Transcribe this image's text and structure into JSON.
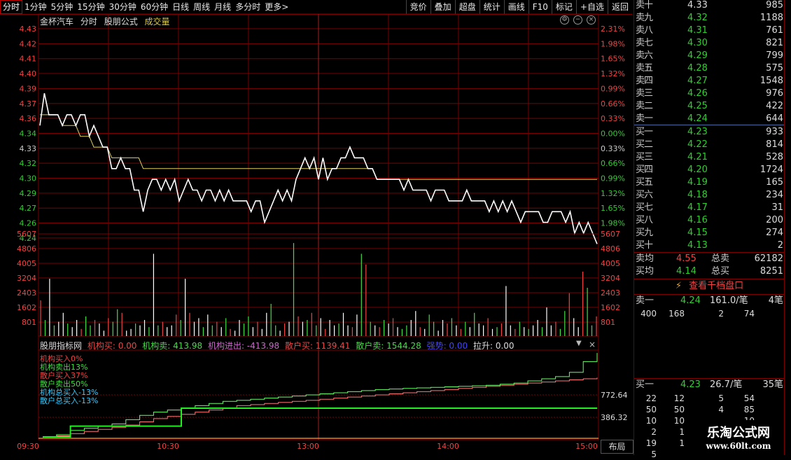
{
  "topbar": {
    "tabs": [
      "分时",
      "1分钟",
      "5分钟",
      "15分钟",
      "30分钟",
      "60分钟",
      "日线",
      "周线",
      "月线",
      "多分时",
      "更多>"
    ],
    "active_tab": "分时",
    "right_buttons": [
      "竞价",
      "叠加",
      "超盘",
      "统计",
      "画线",
      "F10",
      "标记",
      "+自选",
      "返回"
    ]
  },
  "chart_header": {
    "stock_name": "金杯汽车",
    "mode": "分时",
    "formula": "股朋公式",
    "volume_label": "成交量"
  },
  "chart_data": [
    {
      "type": "line",
      "name": "intraday-price",
      "y_ticks_left": [
        "4.43",
        "4.42",
        "4.41",
        "4.40",
        "4.39",
        "4.37",
        "4.36",
        "4.34",
        "4.33",
        "4.32",
        "4.30",
        "4.29",
        "4.27",
        "4.26",
        "4.24"
      ],
      "y_ticks_right": [
        "2.31%",
        "1.98%",
        "1.65%",
        "1.32%",
        "0.99%",
        "0.66%",
        "0.33%",
        "0.00%",
        "0.33%",
        "0.66%",
        "0.99%",
        "1.32%",
        "1.65%",
        "1.98%"
      ],
      "ylim": [
        4.23,
        4.43
      ],
      "prev_close": 4.33,
      "x_ticks": [
        "09:30",
        "10:30",
        "13:00",
        "14:00",
        "15:00"
      ],
      "price": [
        4.34,
        4.37,
        4.35,
        4.35,
        4.35,
        4.34,
        4.35,
        4.35,
        4.34,
        4.35,
        4.35,
        4.33,
        4.34,
        4.33,
        4.32,
        4.32,
        4.3,
        4.3,
        4.31,
        4.3,
        4.3,
        4.28,
        4.28,
        4.26,
        4.28,
        4.29,
        4.29,
        4.28,
        4.29,
        4.28,
        4.29,
        4.27,
        4.28,
        4.29,
        4.28,
        4.28,
        4.27,
        4.28,
        4.28,
        4.27,
        4.28,
        4.27,
        4.28,
        4.27,
        4.27,
        4.27,
        4.27,
        4.26,
        4.27,
        4.27,
        4.25,
        4.26,
        4.27,
        4.28,
        4.27,
        4.28,
        4.27,
        4.29,
        4.3,
        4.31,
        4.3,
        4.31,
        4.29,
        4.31,
        4.29,
        4.3,
        4.3,
        4.31,
        4.31,
        4.32,
        4.31,
        4.31,
        4.31,
        4.3,
        4.3,
        4.29,
        4.29,
        4.29,
        4.29,
        4.29,
        4.29,
        4.28,
        4.29,
        4.28,
        4.28,
        4.28,
        4.28,
        4.27,
        4.28,
        4.28,
        4.28,
        4.27,
        4.27,
        4.27,
        4.27,
        4.28,
        4.27,
        4.27,
        4.27,
        4.27,
        4.26,
        4.27,
        4.26,
        4.27,
        4.26,
        4.27,
        4.26,
        4.25,
        4.26,
        4.26,
        4.26,
        4.26,
        4.25,
        4.25,
        4.26,
        4.26,
        4.26,
        4.25,
        4.26,
        4.24,
        4.25,
        4.24,
        4.25,
        4.24,
        4.23
      ],
      "avg_price": [
        4.35,
        4.35,
        4.35,
        4.35,
        4.35,
        4.34,
        4.34,
        4.34,
        4.34,
        4.33,
        4.33,
        4.33,
        4.32,
        4.32,
        4.32,
        4.32,
        4.31,
        4.31,
        4.31,
        4.31,
        4.31,
        4.31,
        4.31,
        4.3,
        4.3,
        4.3,
        4.3,
        4.3,
        4.3,
        4.3,
        4.3,
        4.3,
        4.3,
        4.3,
        4.3,
        4.3,
        4.3,
        4.3,
        4.3,
        4.3,
        4.3,
        4.3,
        4.3,
        4.3,
        4.3,
        4.3,
        4.3,
        4.3,
        4.3,
        4.3,
        4.3,
        4.3,
        4.3,
        4.3,
        4.3,
        4.3,
        4.3,
        4.3,
        4.3,
        4.3,
        4.3,
        4.3,
        4.3,
        4.3,
        4.3,
        4.3,
        4.3,
        4.3,
        4.3,
        4.3,
        4.3,
        4.3,
        4.3,
        4.3,
        4.3,
        4.29,
        4.29,
        4.29,
        4.29,
        4.29,
        4.29,
        4.29,
        4.29,
        4.29,
        4.29,
        4.29,
        4.29,
        4.29,
        4.29,
        4.29,
        4.29,
        4.29,
        4.29,
        4.29,
        4.29,
        4.29,
        4.29,
        4.29,
        4.29,
        4.29,
        4.29,
        4.29,
        4.29,
        4.29,
        4.29,
        4.29,
        4.29,
        4.29,
        4.29,
        4.29,
        4.29,
        4.29,
        4.29,
        4.29,
        4.29,
        4.29,
        4.29,
        4.29,
        4.29,
        4.29,
        4.29,
        4.29,
        4.29,
        4.29,
        4.29
      ]
    },
    {
      "type": "bar",
      "name": "volume",
      "y_ticks": [
        "5607",
        "4806",
        "4005",
        "3204",
        "2403",
        "1602",
        "801"
      ],
      "ylim": [
        0,
        6000
      ],
      "values": [
        2000,
        900,
        3200,
        600,
        800,
        1300,
        700,
        500,
        900,
        400,
        1100,
        600,
        900,
        700,
        300,
        1000,
        800,
        1500,
        1300,
        300,
        400,
        700,
        600,
        900,
        500,
        4600,
        600,
        800,
        500,
        600,
        1200,
        900,
        3200,
        1300,
        800,
        1000,
        500,
        1200,
        600,
        800,
        500,
        1000,
        400,
        300,
        900,
        700,
        1100,
        500,
        800,
        400,
        1300,
        1800,
        600,
        300,
        700,
        800,
        5200,
        1100,
        800,
        900,
        1300,
        600,
        1000,
        400,
        900,
        600,
        700,
        1300,
        600,
        500,
        1200,
        4600,
        4000,
        800,
        600,
        500,
        900,
        700,
        1000,
        500,
        400,
        600,
        900,
        1400,
        500,
        400,
        1200,
        800,
        300,
        900,
        700,
        1000,
        600,
        400,
        800,
        500,
        1300,
        700,
        600,
        1000,
        400,
        500,
        700,
        2800,
        600,
        400,
        800,
        500,
        400,
        600,
        900,
        500,
        1600,
        600,
        800,
        400,
        1400,
        2400,
        1000,
        500,
        3600,
        2700,
        600,
        1100
      ],
      "colors_up": "#e44",
      "colors_down": "#4d4"
    },
    {
      "type": "line",
      "name": "capital-flow",
      "y_ticks": [
        "772.64",
        "386.32"
      ],
      "series": [
        {
          "color": "#6f6",
          "values": [
            0,
            20,
            60,
            80,
            100,
            120,
            160,
            200,
            230,
            250,
            270,
            290,
            310,
            330,
            340,
            350,
            360,
            370,
            380,
            390,
            400,
            410,
            420,
            430,
            440,
            445,
            450,
            455,
            460,
            465,
            470,
            475,
            480,
            490,
            500,
            520,
            540,
            560,
            600,
            700,
            780
          ]
        },
        {
          "color": "#f77",
          "values": [
            0,
            10,
            30,
            50,
            70,
            90,
            110,
            140,
            170,
            190,
            210,
            230,
            250,
            270,
            290,
            300,
            310,
            320,
            330,
            340,
            350,
            360,
            370,
            380,
            390,
            400,
            410,
            420,
            430,
            440,
            450,
            460,
            470,
            480,
            490,
            500,
            510,
            520,
            530,
            540,
            550
          ]
        },
        {
          "color": "#2e2",
          "values": [
            0,
            0,
            60,
            60,
            60,
            60,
            60,
            60,
            60,
            60,
            160,
            160,
            160,
            160,
            160,
            160,
            160,
            160,
            160,
            160,
            160,
            160,
            160,
            160,
            160,
            160,
            160,
            160,
            160,
            160,
            160,
            160,
            160,
            160,
            160,
            160,
            160,
            160,
            160,
            160,
            160
          ]
        }
      ]
    }
  ],
  "indicator_bar": {
    "name": "股朋指标网",
    "inst_buy": "机构买: 0.00",
    "inst_sell": "机构卖: 413.98",
    "inst_net": "机构进出: -413.98",
    "retail_buy": "散户买: 1139.41",
    "retail_sell": "散户卖: 1544.28",
    "strength": "强势: 0.00",
    "pull": "拉升: 0.00"
  },
  "legend": [
    "机构买入0%",
    "机构卖出13%",
    "散户买入37%",
    "散户卖出50%",
    "机构总买入-13%",
    "散户总买入-13%"
  ],
  "bottom": {
    "layout_button": "布局"
  },
  "quotes": {
    "sell": [
      {
        "label": "卖十",
        "price": "4.33",
        "vol": "985",
        "color": "#ddd"
      },
      {
        "label": "卖九",
        "price": "4.32",
        "vol": "1188",
        "color": "#3c3"
      },
      {
        "label": "卖八",
        "price": "4.31",
        "vol": "761",
        "color": "#3c3"
      },
      {
        "label": "卖七",
        "price": "4.30",
        "vol": "821",
        "color": "#3c3"
      },
      {
        "label": "卖六",
        "price": "4.29",
        "vol": "799",
        "color": "#3c3"
      },
      {
        "label": "卖五",
        "price": "4.28",
        "vol": "575",
        "color": "#3c3"
      },
      {
        "label": "卖四",
        "price": "4.27",
        "vol": "1548",
        "color": "#3c3"
      },
      {
        "label": "卖三",
        "price": "4.26",
        "vol": "976",
        "color": "#3c3"
      },
      {
        "label": "卖二",
        "price": "4.25",
        "vol": "422",
        "color": "#3c3"
      },
      {
        "label": "卖一",
        "price": "4.24",
        "vol": "644",
        "color": "#3c3"
      }
    ],
    "buy": [
      {
        "label": "买一",
        "price": "4.23",
        "vol": "933",
        "color": "#3c3"
      },
      {
        "label": "买二",
        "price": "4.22",
        "vol": "814",
        "color": "#3c3"
      },
      {
        "label": "买三",
        "price": "4.21",
        "vol": "528",
        "color": "#3c3"
      },
      {
        "label": "买四",
        "price": "4.20",
        "vol": "1724",
        "color": "#3c3"
      },
      {
        "label": "买五",
        "price": "4.19",
        "vol": "165",
        "color": "#3c3"
      },
      {
        "label": "买六",
        "price": "4.18",
        "vol": "234",
        "color": "#3c3"
      },
      {
        "label": "买七",
        "price": "4.17",
        "vol": "31",
        "color": "#3c3"
      },
      {
        "label": "买八",
        "price": "4.16",
        "vol": "200",
        "color": "#3c3"
      },
      {
        "label": "买九",
        "price": "4.15",
        "vol": "274",
        "color": "#3c3"
      },
      {
        "label": "买十",
        "price": "4.13",
        "vol": "2",
        "color": "#3c3"
      }
    ],
    "sell_avg_label": "卖均",
    "sell_avg": "4.55",
    "total_sell_label": "总卖",
    "total_sell": "62182",
    "buy_avg_label": "买均",
    "buy_avg": "4.14",
    "total_buy_label": "总买",
    "total_buy": "8251",
    "depth_button": "查看千档盘口",
    "ask1": {
      "label": "卖一",
      "price": "4.24",
      "qty": "161.0/笔",
      "count": "4笔"
    },
    "ask1_orders": [
      "400",
      "168",
      "2",
      "74"
    ],
    "bid1": {
      "label": "买一",
      "price": "4.23",
      "qty": "26.7/笔",
      "count": "35笔"
    },
    "bid1_orders": [
      [
        "22",
        "12",
        "5",
        "54"
      ],
      [
        "50",
        "50",
        "4",
        "85"
      ],
      [
        "10",
        "10",
        "",
        "10"
      ],
      [
        "2",
        "1",
        "",
        ""
      ],
      [
        "19",
        "1",
        "",
        ""
      ],
      [
        "5",
        "",
        "",
        ""
      ]
    ]
  },
  "watermark": {
    "title": "乐淘公式网",
    "url": "www.60lt.com"
  },
  "colors": {
    "grid": "#7a0000",
    "price_line": "#ffffff",
    "avg_line": "#e0d060",
    "up": "#e44",
    "down": "#3c3"
  }
}
